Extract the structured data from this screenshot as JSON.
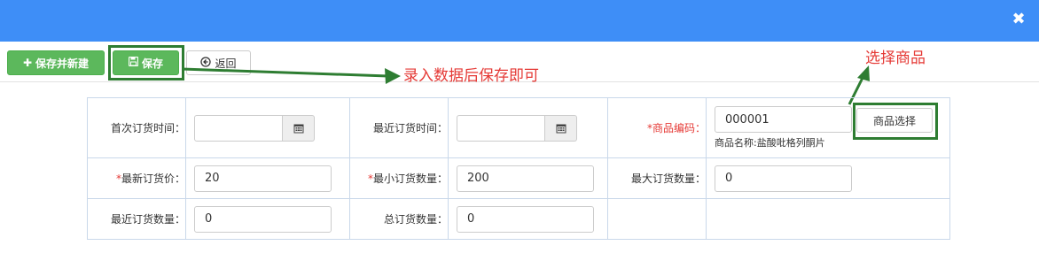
{
  "dialog": {
    "close_glyph": "✖",
    "title_color": "#3e8ef7"
  },
  "toolbar": {
    "save_new_label": "保存并新建",
    "save_label": "保存",
    "back_label": "返回",
    "save_new_icon": "plus-icon",
    "save_icon": "floppy-disk-icon",
    "back_icon": "circle-arrow-left-icon"
  },
  "annotations": {
    "save_hint": "录入数据后保存即可",
    "select_hint": "选择商品",
    "arrow_color": "#2e7d32",
    "text_color": "#e53935"
  },
  "form": {
    "first_order_time": {
      "label": "首次订货时间：",
      "value": ""
    },
    "last_order_time": {
      "label": "最近订货时间：",
      "value": ""
    },
    "product_code": {
      "required": "*",
      "label": "商品编码：",
      "value": "000001",
      "product_name": "商品名称:盐酸吡格列酮片",
      "select_button": "商品选择"
    },
    "latest_price": {
      "required": "*",
      "label": "最新订货价：",
      "value": "20"
    },
    "min_qty": {
      "required": "*",
      "label": "最小订货数量：",
      "value": "200"
    },
    "max_qty": {
      "label": "最大订货数量：",
      "value": "0"
    },
    "recent_qty": {
      "label": "最近订货数量：",
      "value": "0"
    },
    "total_qty": {
      "label": "总订货数量：",
      "value": "0"
    }
  }
}
